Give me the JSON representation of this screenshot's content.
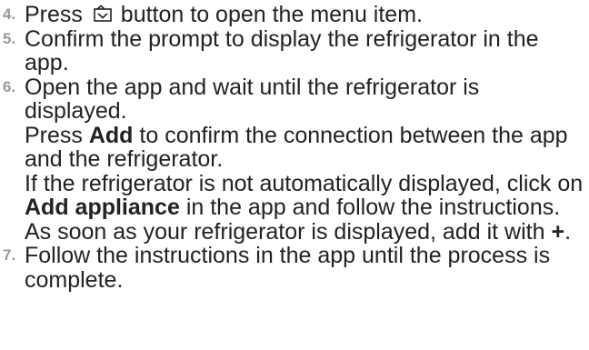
{
  "steps": [
    {
      "number": "4.",
      "before_icon": "Press ",
      "icon": "menu-button-icon",
      "after_icon": " button to open the menu item."
    },
    {
      "number": "5.",
      "text": "Confirm the prompt to display the refrigerator in the app."
    },
    {
      "number": "6.",
      "p1": "Open the app and wait until the refrigerator is displayed.",
      "p2_before": "Press ",
      "p2_bold": "Add",
      "p2_after": " to confirm the connection between the app and the refrigerator.",
      "p3_before": "If the refrigerator is not automatically displayed, click on ",
      "p3_bold": "Add appliance",
      "p3_mid": " in the app and follow the instructions. As soon as your refrigerator is displayed, add it with ",
      "p3_plus": "+",
      "p3_end": "."
    },
    {
      "number": "7.",
      "text": "Follow the instructions in the app until the process is complete."
    }
  ],
  "colors": {
    "text": "#222222",
    "step_number": "#9a9a9a"
  }
}
